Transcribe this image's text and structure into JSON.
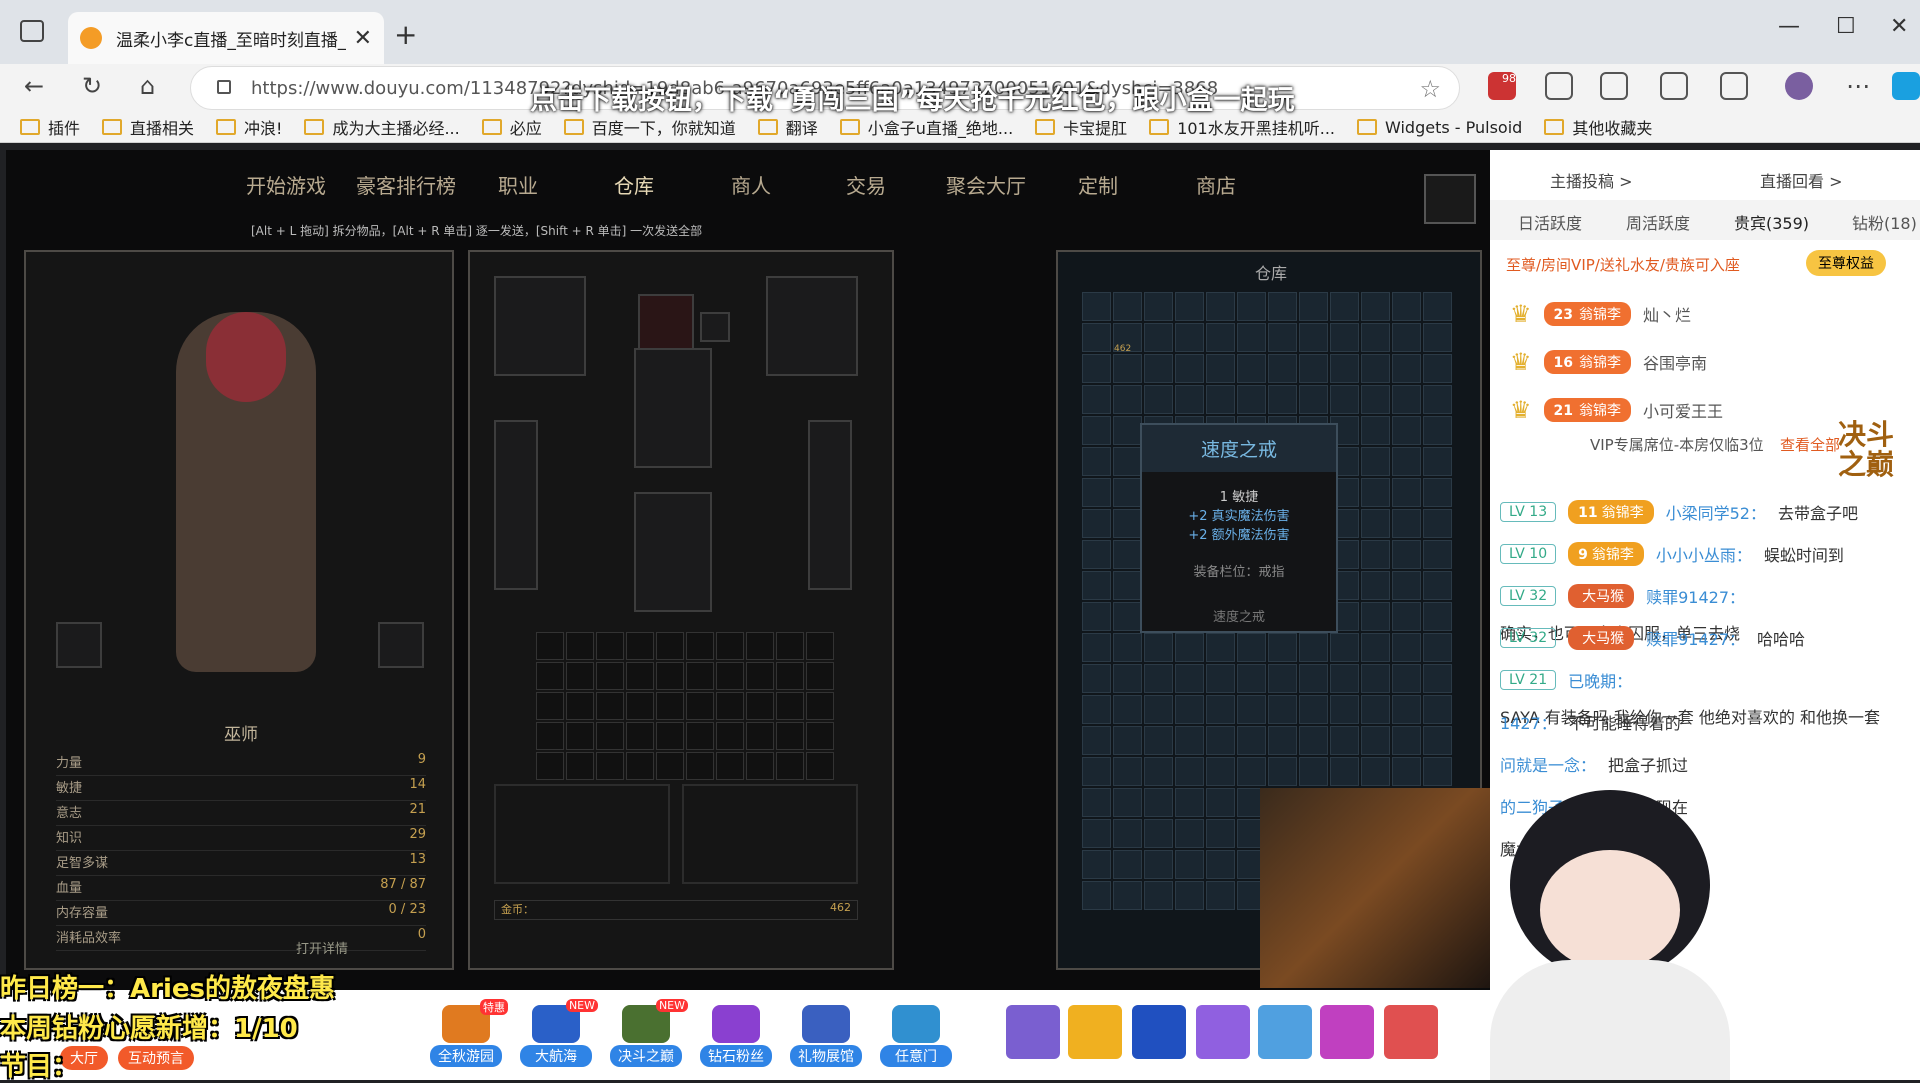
{
  "browser": {
    "tab_title": "温柔小李c直播_至暗时刻直播_斗",
    "url": "https://www.douyu.com/11348792?dyshid=19d8ab6-a9670a693e5ff6a0a134973700051601&dyshci=3868",
    "ext_badge": "98"
  },
  "bookmarks": [
    "插件",
    "直播相关",
    "冲浪!",
    "成为大主播必经...",
    "必应",
    "百度一下，你就知道",
    "翻译",
    "小盒子u直播_绝地...",
    "卡宝提肛",
    "101水友开黑挂机听...",
    "Widgets - Pulsoid",
    "其他收藏夹"
  ],
  "promo": "点击下载按钮，下载“勇闯三国”每天抢千元红包，跟小盒一起玩",
  "game": {
    "tabs": [
      "开始游戏",
      "豪客排行榜",
      "职业",
      "仓库",
      "商人",
      "交易",
      "聚会大厅",
      "定制",
      "商店"
    ],
    "hint": "[Alt + L 拖动] 拆分物品，[Alt + R 单击] 逐一发送，[Shift + R 单击] 一次发送全部",
    "class_name": "巫师",
    "stats": [
      {
        "k": "力量",
        "v": "9"
      },
      {
        "k": "敏捷",
        "v": "14"
      },
      {
        "k": "意志",
        "v": "21"
      },
      {
        "k": "知识",
        "v": "29"
      },
      {
        "k": "足智多谋",
        "v": "13"
      },
      {
        "k": "血量",
        "v": "87 / 87"
      },
      {
        "k": "内存容量",
        "v": "0 / 23"
      },
      {
        "k": "消耗品效率",
        "v": "0"
      }
    ],
    "details_btn": "打开详情",
    "gold_label": "金币：",
    "gold_value": "462",
    "stash_title": "仓库",
    "stack_count": "462",
    "tooltip": {
      "title": "速度之戒",
      "lines": [
        "1 敏捷",
        "+2 真实魔法伤害",
        "+2 额外魔法伤害"
      ],
      "slot": "装备栏位：戒指",
      "footer": "速度之戒"
    }
  },
  "sidebar": {
    "top_links": [
      "主播投稿 >",
      "直播回看 >"
    ],
    "tabs": [
      "日活跃度",
      "周活跃度",
      "贵宾(359)",
      "钻粉(18)"
    ],
    "vip_text": "至尊/房间VIP/送礼水友/贵族可入座",
    "vip_btn": "至尊权益",
    "vips": [
      {
        "lvl": "23",
        "badge": "翁锦李",
        "name": "灿丶烂"
      },
      {
        "lvl": "16",
        "badge": "翁锦李",
        "name": "谷围亭南"
      },
      {
        "lvl": "21",
        "badge": "翁锦李",
        "name": "小可爱王王"
      }
    ],
    "vip_more": "VIP专属席位-本房仅临3位",
    "see_all": "查看全部",
    "chat": [
      {
        "lv": "LV 13",
        "bl": "11",
        "badge": "翁锦李",
        "user": "小梁同学52：",
        "msg": "去带盒子吧"
      },
      {
        "lv": "LV 10",
        "bl": "9",
        "badge": "翁锦李",
        "user": "小小小丛雨：",
        "msg": "蜈蚣时间到"
      },
      {
        "lv": "LV 32",
        "bl": "",
        "badge": "大马猴",
        "user": "赎罪91427：",
        "msg": "确实，也可以穿点囚服，单三去烧"
      },
      {
        "lv": "LV 32",
        "bl": "",
        "badge": "大马猴",
        "user": "赎罪91427：",
        "msg": "哈哈哈"
      },
      {
        "lv": "LV 21",
        "bl": "",
        "badge": "",
        "user": "已晚期：",
        "msg": "SAYA 有装备吗 我给你一套 他绝对喜欢的 和他换一套"
      },
      {
        "lv": "",
        "bl": "",
        "badge": "",
        "user": "1427：",
        "msg": "不可能睡得着的"
      },
      {
        "lv": "",
        "bl": "",
        "badge": "",
        "user": "问就是一念：",
        "msg": "把盒子抓过"
      },
      {
        "lv": "",
        "bl": "",
        "badge": "",
        "user": "的二狗子：",
        "msg": "你这作息现在"
      },
      {
        "lv": "",
        "bl": "",
        "badge": "",
        "user": "",
        "msg": "魔术士和盗贼，神特喵鼠鼠"
      }
    ]
  },
  "overlay": {
    "line1": "昨日榜一：Aries的敖夜盘惠",
    "line2": "本周钻粉心愿新增：1/10",
    "line3": "节目："
  },
  "bottom_btns": [
    "大厅",
    "互动预言"
  ],
  "activities": [
    {
      "label": "全秋游园",
      "tag": "特惠"
    },
    {
      "label": "大航海",
      "tag": "NEW"
    },
    {
      "label": "决斗之巅",
      "tag": "NEW"
    },
    {
      "label": "钻石粉丝",
      "tag": ""
    },
    {
      "label": "礼物展馆",
      "tag": ""
    },
    {
      "label": "任意门",
      "tag": ""
    }
  ],
  "game_logo": "决斗之巅"
}
